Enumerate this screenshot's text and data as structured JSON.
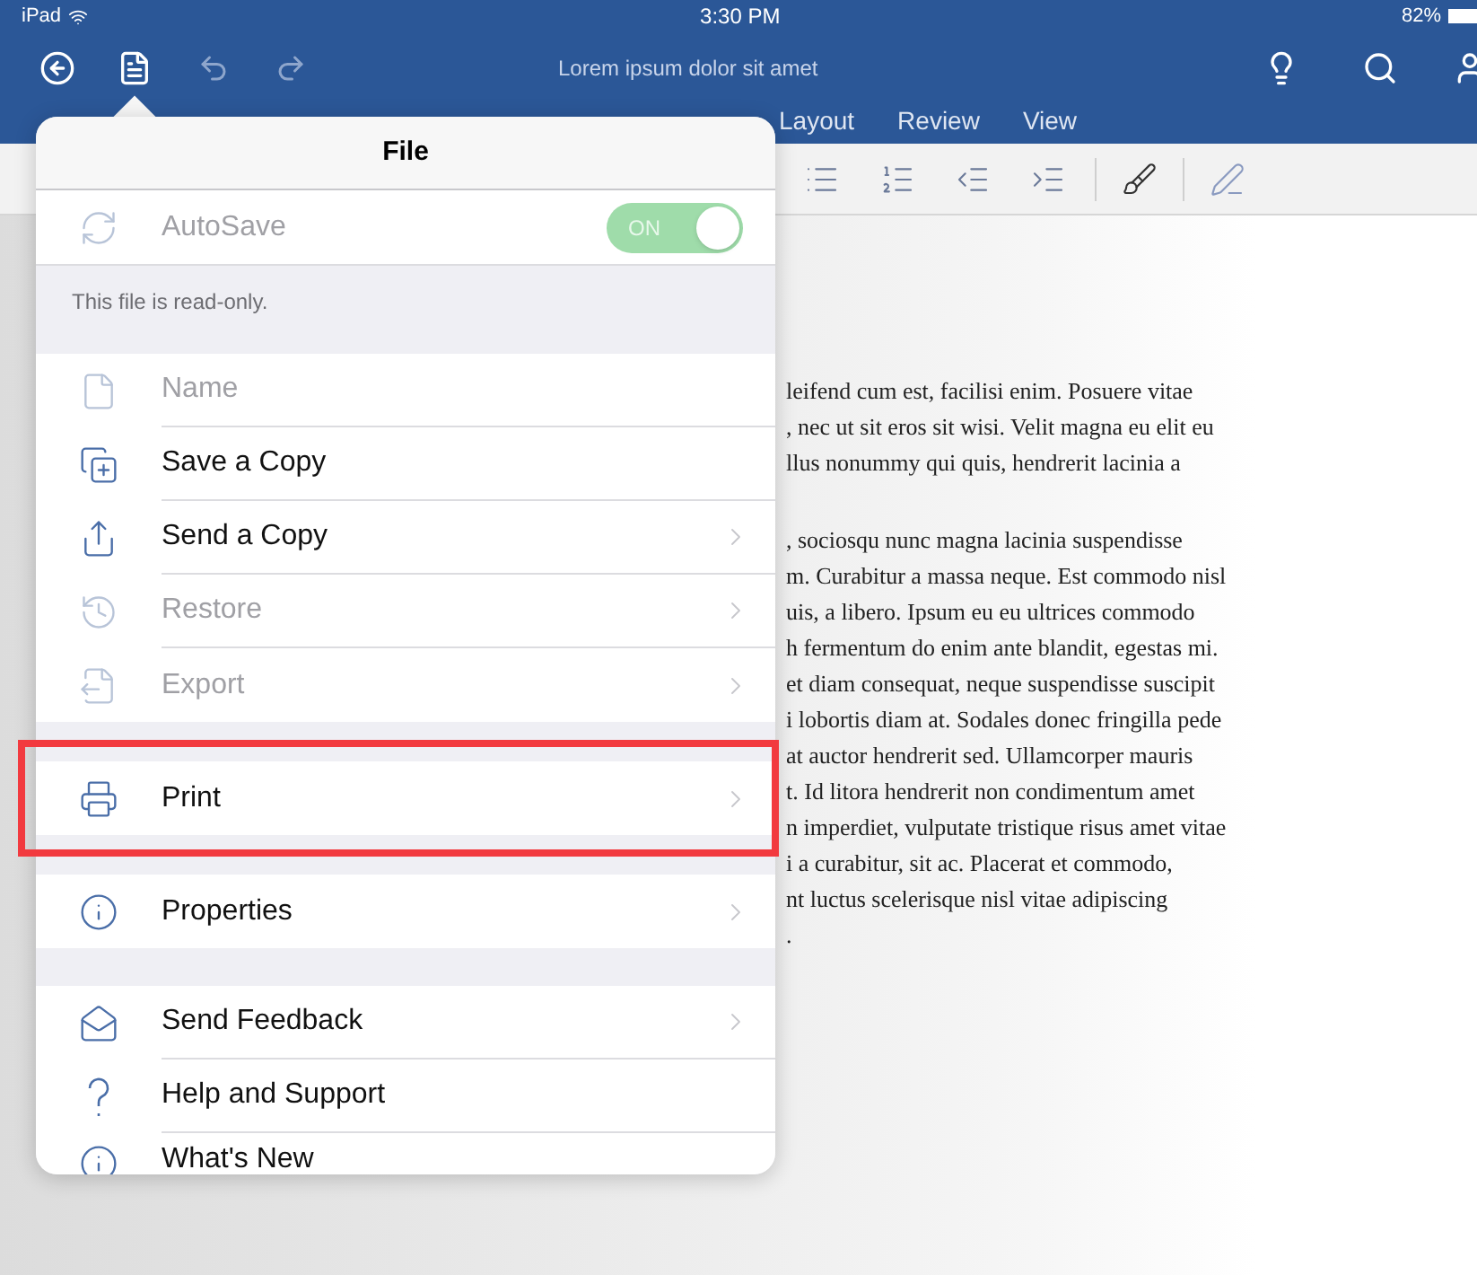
{
  "status_bar": {
    "device": "iPad",
    "time": "3:30 PM",
    "battery": "82%"
  },
  "window": {
    "title": "Lorem ipsum dolor sit amet"
  },
  "tabs": [
    {
      "label": "Layout",
      "selected": false
    },
    {
      "label": "Review",
      "selected": false
    },
    {
      "label": "View",
      "selected": false
    }
  ],
  "menu": {
    "title": "File",
    "groups": [
      {
        "items": [
          {
            "kind": "toggle",
            "label": "AutoSave",
            "on": true,
            "switch_text": "ON",
            "disabled": true
          },
          {
            "kind": "note",
            "label": "This file is read-only."
          }
        ]
      },
      {
        "items": [
          {
            "kind": "item",
            "label": "Name",
            "disabled": true,
            "chevron": false
          },
          {
            "kind": "item",
            "label": "Save a Copy",
            "disabled": false,
            "chevron": false
          },
          {
            "kind": "item",
            "label": "Send a Copy",
            "disabled": false,
            "chevron": true
          },
          {
            "kind": "item",
            "label": "Restore",
            "disabled": true,
            "chevron": true
          },
          {
            "kind": "item",
            "label": "Export",
            "disabled": true,
            "chevron": true
          }
        ]
      },
      {
        "items": [
          {
            "kind": "item",
            "label": "Print",
            "disabled": false,
            "chevron": true,
            "highlighted": true
          }
        ]
      },
      {
        "items": [
          {
            "kind": "item",
            "label": "Properties",
            "disabled": false,
            "chevron": true
          }
        ]
      },
      {
        "items": [
          {
            "kind": "item",
            "label": "Send Feedback",
            "disabled": false,
            "chevron": true
          },
          {
            "kind": "item",
            "label": "Help and Support",
            "disabled": false,
            "chevron": false
          },
          {
            "kind": "item",
            "label": "What's New",
            "disabled": false,
            "chevron": false
          }
        ]
      }
    ]
  },
  "document": {
    "paragraphs": [
      [
        "leifend cum est, facilisi enim. Posuere vitae",
        ", nec ut sit eros sit wisi. Velit magna eu elit eu",
        "llus nonummy qui quis, hendrerit lacinia a"
      ],
      [
        ", sociosqu nunc magna lacinia suspendisse",
        "m. Curabitur a massa neque. Est commodo nisl",
        "uis, a libero. Ipsum eu eu ultrices commodo",
        "h fermentum do enim ante blandit, egestas mi.",
        "et diam consequat, neque suspendisse suscipit",
        "i lobortis diam at. Sodales donec fringilla pede",
        "at auctor hendrerit sed. Ullamcorper mauris",
        "t. Id litora hendrerit non condimentum amet",
        "n imperdiet, vulputate tristique risus amet vitae",
        "i a curabitur, sit ac. Placerat et commodo,",
        "nt luctus scelerisque nisl vitae adipiscing",
        "."
      ]
    ]
  }
}
